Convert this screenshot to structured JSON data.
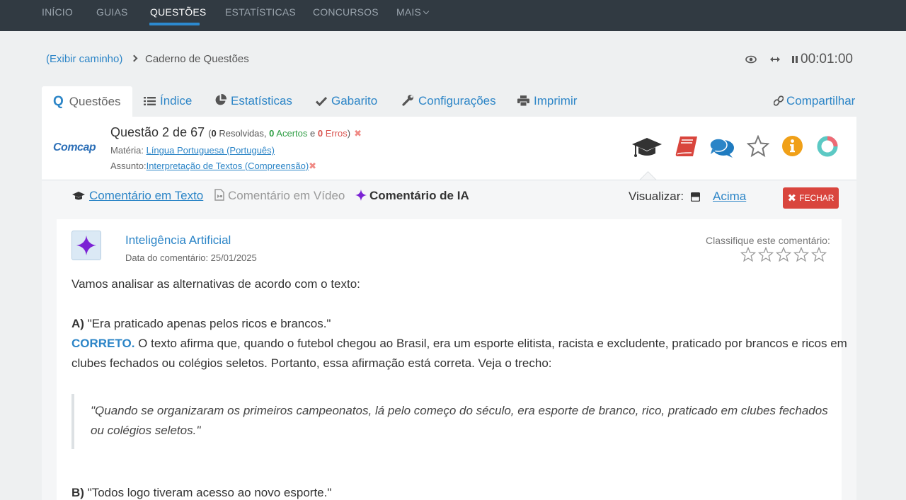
{
  "nav": {
    "items": [
      "INÍCIO",
      "GUIAS",
      "QUESTÕES",
      "ESTATÍSTICAS",
      "CONCURSOS",
      "MAIS"
    ]
  },
  "breadcrumb": {
    "show_path": "(Exibir caminho)",
    "current": "Caderno de Questões"
  },
  "timer": "00:01:00",
  "tabs": {
    "questoes": "Questões",
    "indice": "Índice",
    "estatisticas": "Estatísticas",
    "gabarito": "Gabarito",
    "configuracoes": "Configurações",
    "imprimir": "Imprimir",
    "compartilhar": "Compartilhar"
  },
  "question": {
    "logo": "Comcap",
    "title": "Questão 2 de 67",
    "resolvidas_count": "0",
    "resolvidas_label": "Resolvidas,",
    "acertos_count": "0",
    "acertos_label": "Acertos",
    "and_word": "e",
    "erros_count": "0",
    "erros_label": "Erros",
    "materia_label": "Matéria:",
    "materia": "Língua Portuguesa (Português)",
    "assunto_label": "Assunto:",
    "assunto": "Interpretação de Textos (Compreensão)"
  },
  "comment_tabs": {
    "texto": "Comentário em Texto",
    "video": "Comentário em Vídeo",
    "ia": "Comentário de IA",
    "visualizar_label": "Visualizar:",
    "visualizar_value": "Acima",
    "fechar": "FECHAR"
  },
  "comment": {
    "author": "Inteligência Artificial",
    "date": "Data do comentário: 25/01/2025",
    "rate_label": "Classifique este comentário:",
    "rating": 0,
    "intro": "Vamos analisar as alternativas de acordo com o texto:",
    "a_label": "A)",
    "a_text": "\"Era praticado apenas pelos ricos e brancos.\"",
    "a_verdict": "CORRETO.",
    "a_line1": "O texto afirma que, quando o futebol chegou ao Brasil, era um esporte elitista, racista e excludente, praticado por brancos e ricos em",
    "a_line2": "clubes fechados ou colégios seletos. Portanto, essa afirmação está correta. Veja o trecho:",
    "quote_line1": "\"Quando se organizaram os primeiros campeonatos, lá pelo começo do século, era esporte de branco, rico, praticado em clubes fechados",
    "quote_line2": "ou colégios seletos.\"",
    "b_label": "B)",
    "b_text": "\"Todos logo tiveram acesso ao novo esporte.\""
  },
  "colors": {
    "nav_bg": "#313a42",
    "accent": "#2c85c7",
    "close_button": "#d9453d",
    "ia_star": "#7b22d4"
  }
}
